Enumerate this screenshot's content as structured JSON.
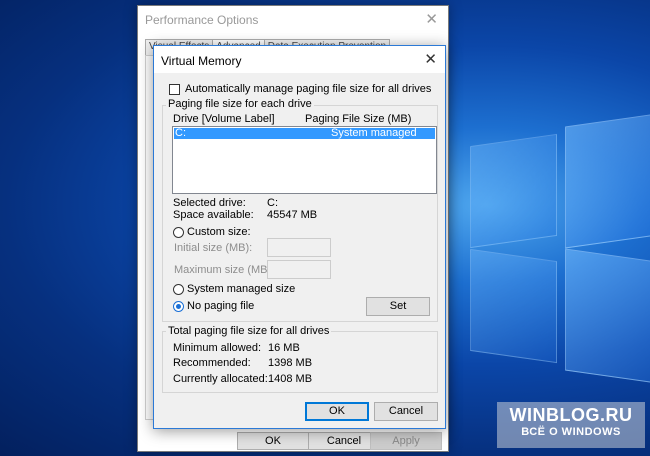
{
  "performance_options": {
    "title": "Performance Options",
    "tabs": [
      {
        "label": "Visual Effects"
      },
      {
        "label": "Advanced"
      },
      {
        "label": "Data Execution Prevention"
      }
    ],
    "ok_label": "OK",
    "cancel_label": "Cancel",
    "apply_label": "Apply"
  },
  "virtual_memory": {
    "title": "Virtual Memory",
    "auto_manage_label": "Automatically manage paging file size for all drives",
    "auto_manage_checked": false,
    "group_each_drive": "Paging file size for each drive",
    "columns": {
      "drive": "Drive  [Volume Label]",
      "size": "Paging File Size (MB)"
    },
    "drives": [
      {
        "drive": "C:",
        "size": "System managed",
        "selected": true
      }
    ],
    "selected_drive_label": "Selected drive:",
    "selected_drive_value": "C:",
    "space_available_label": "Space available:",
    "space_available_value": "45547 MB",
    "custom_size_label": "Custom size:",
    "initial_size_label": "Initial size (MB):",
    "initial_size_value": "",
    "maximum_size_label": "Maximum size (MB):",
    "maximum_size_value": "",
    "system_managed_label": "System managed size",
    "no_paging_label": "No paging file",
    "selected_option": "no_paging",
    "set_label": "Set",
    "group_total": "Total paging file size for all drives",
    "minimum_allowed_label": "Minimum allowed:",
    "minimum_allowed_value": "16 MB",
    "recommended_label": "Recommended:",
    "recommended_value": "1398 MB",
    "currently_allocated_label": "Currently allocated:",
    "currently_allocated_value": "1408 MB",
    "ok_label": "OK",
    "cancel_label": "Cancel"
  },
  "watermark": {
    "line1": "WINBLOG.RU",
    "line2": "ВСЁ О WINDOWS"
  },
  "icons": {
    "close": "close-icon"
  }
}
